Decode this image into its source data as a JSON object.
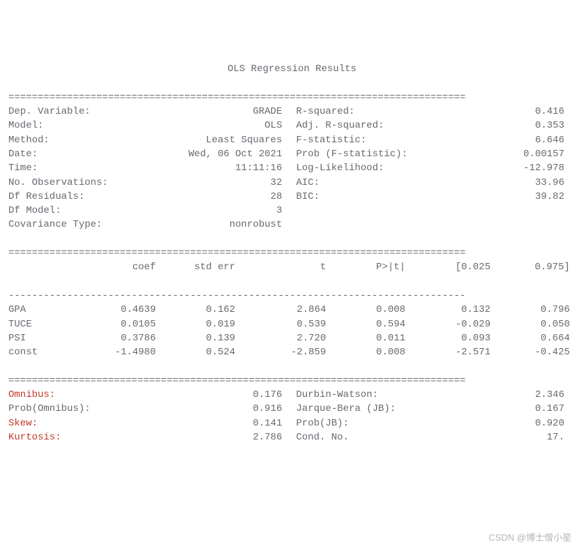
{
  "title": "OLS Regression Results",
  "rule_eq": "==============================================================================",
  "rule_dash": "------------------------------------------------------------------------------",
  "top_left": [
    {
      "label": "Dep. Variable:",
      "value": "GRADE"
    },
    {
      "label": "Model:",
      "value": "OLS"
    },
    {
      "label": "Method:",
      "value": "Least Squares"
    },
    {
      "label": "Date:",
      "value": "Wed, 06 Oct 2021"
    },
    {
      "label": "Time:",
      "value": "11:11:16"
    },
    {
      "label": "No. Observations:",
      "value": "32"
    },
    {
      "label": "Df Residuals:",
      "value": "28"
    },
    {
      "label": "Df Model:",
      "value": "3"
    },
    {
      "label": "Covariance Type:",
      "value": "nonrobust"
    }
  ],
  "top_right": [
    {
      "label": "R-squared:",
      "value": "0.416"
    },
    {
      "label": "Adj. R-squared:",
      "value": "0.353"
    },
    {
      "label": "F-statistic:",
      "value": "6.646"
    },
    {
      "label": "Prob (F-statistic):",
      "value": "0.00157"
    },
    {
      "label": "Log-Likelihood:",
      "value": "-12.978"
    },
    {
      "label": "AIC:",
      "value": "33.96"
    },
    {
      "label": "BIC:",
      "value": "39.82"
    },
    {
      "label": "",
      "value": ""
    },
    {
      "label": "",
      "value": ""
    }
  ],
  "coef_headers": {
    "c0": "",
    "c1": "coef",
    "c2": "std err",
    "c3": "t",
    "c4": "P>|t|",
    "c5": "[0.025",
    "c6": "0.975]"
  },
  "coef_rows": [
    {
      "name": "GPA",
      "coef": "0.4639",
      "se": "0.162",
      "t": "2.864",
      "p": "0.008",
      "lo": "0.132",
      "hi": "0.796"
    },
    {
      "name": "TUCE",
      "coef": "0.0105",
      "se": "0.019",
      "t": "0.539",
      "p": "0.594",
      "lo": "-0.029",
      "hi": "0.050"
    },
    {
      "name": "PSI",
      "coef": "0.3786",
      "se": "0.139",
      "t": "2.720",
      "p": "0.011",
      "lo": "0.093",
      "hi": "0.664"
    },
    {
      "name": "const",
      "coef": "-1.4980",
      "se": "0.524",
      "t": "-2.859",
      "p": "0.008",
      "lo": "-2.571",
      "hi": "-0.425"
    }
  ],
  "diag_left": [
    {
      "label": "Omnibus:",
      "value": "0.176",
      "red": true
    },
    {
      "label": "Prob(Omnibus):",
      "value": "0.916",
      "red": false
    },
    {
      "label": "Skew:",
      "value": "0.141",
      "red": true
    },
    {
      "label": "Kurtosis:",
      "value": "2.786",
      "red": true
    }
  ],
  "diag_right": [
    {
      "label": "Durbin-Watson:",
      "value": "2.346"
    },
    {
      "label": "Jarque-Bera (JB):",
      "value": "0.167"
    },
    {
      "label": "Prob(JB):",
      "value": "0.920"
    },
    {
      "label": "Cond. No.",
      "value": "17."
    }
  ],
  "watermark": "CSDN @博士僧小星",
  "chart_data": {
    "type": "table",
    "title": "OLS Regression Results",
    "summary_stats": {
      "dep_variable": "GRADE",
      "model": "OLS",
      "method": "Least Squares",
      "date": "Wed, 06 Oct 2021",
      "time": "11:11:16",
      "n_observations": 32,
      "df_residuals": 28,
      "df_model": 3,
      "covariance_type": "nonrobust",
      "r_squared": 0.416,
      "adj_r_squared": 0.353,
      "f_statistic": 6.646,
      "prob_f_statistic": 0.00157,
      "log_likelihood": -12.978,
      "aic": 33.96,
      "bic": 39.82
    },
    "coefficients": [
      {
        "variable": "GPA",
        "coef": 0.4639,
        "std_err": 0.162,
        "t": 2.864,
        "p": 0.008,
        "ci_low": 0.132,
        "ci_high": 0.796
      },
      {
        "variable": "TUCE",
        "coef": 0.0105,
        "std_err": 0.019,
        "t": 0.539,
        "p": 0.594,
        "ci_low": -0.029,
        "ci_high": 0.05
      },
      {
        "variable": "PSI",
        "coef": 0.3786,
        "std_err": 0.139,
        "t": 2.72,
        "p": 0.011,
        "ci_low": 0.093,
        "ci_high": 0.664
      },
      {
        "variable": "const",
        "coef": -1.498,
        "std_err": 0.524,
        "t": -2.859,
        "p": 0.008,
        "ci_low": -2.571,
        "ci_high": -0.425
      }
    ],
    "diagnostics": {
      "omnibus": 0.176,
      "prob_omnibus": 0.916,
      "skew": 0.141,
      "kurtosis": 2.786,
      "durbin_watson": 2.346,
      "jarque_bera": 0.167,
      "prob_jb": 0.92,
      "cond_no": 17.0
    }
  }
}
